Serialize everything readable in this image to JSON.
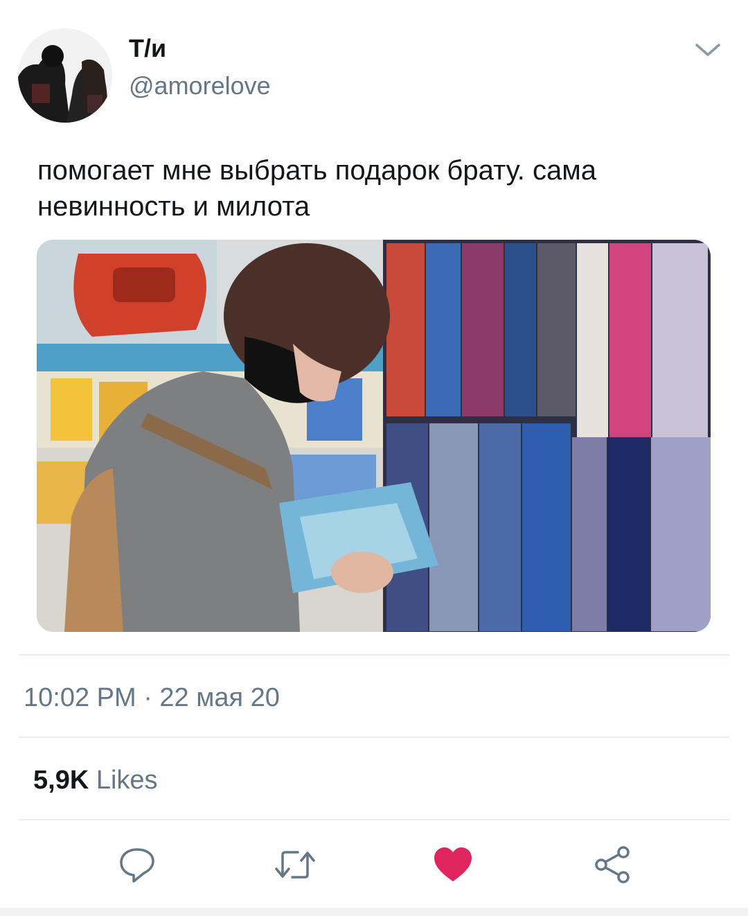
{
  "tweet": {
    "author": {
      "display_name": "Т/и",
      "handle": "@amorelove",
      "avatar_icon": "avatar-photo"
    },
    "text": "помогает мне выбрать подарок брату. сама невинность и милота",
    "media_icon": "photo",
    "timestamp": "10:02 PM · 22 мая 20",
    "likes_count": "5,9K",
    "likes_label": "Likes",
    "menu_icon": "chevron-down-icon"
  },
  "actions": [
    {
      "name": "reply",
      "icon": "reply-icon"
    },
    {
      "name": "retweet",
      "icon": "retweet-icon"
    },
    {
      "name": "like",
      "icon": "heart-icon",
      "active": true
    },
    {
      "name": "share",
      "icon": "share-icon"
    }
  ],
  "colors": {
    "text_primary": "#14171a",
    "text_secondary": "#657786",
    "divider": "#e6ecf0",
    "like_active": "#e0245e",
    "icon_gray": "#657786"
  }
}
